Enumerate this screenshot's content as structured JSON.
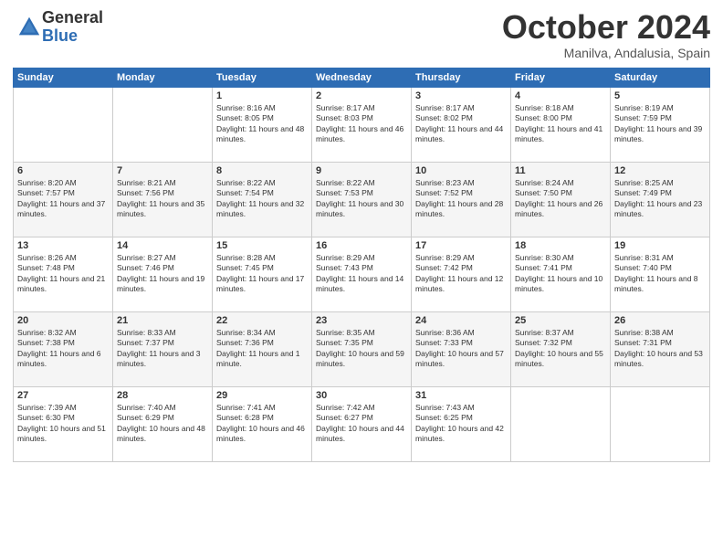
{
  "logo": {
    "general": "General",
    "blue": "Blue"
  },
  "title": "October 2024",
  "subtitle": "Manilva, Andalusia, Spain",
  "days_of_week": [
    "Sunday",
    "Monday",
    "Tuesday",
    "Wednesday",
    "Thursday",
    "Friday",
    "Saturday"
  ],
  "weeks": [
    [
      {
        "day": "",
        "info": ""
      },
      {
        "day": "",
        "info": ""
      },
      {
        "day": "1",
        "info": "Sunrise: 8:16 AM\nSunset: 8:05 PM\nDaylight: 11 hours and 48 minutes."
      },
      {
        "day": "2",
        "info": "Sunrise: 8:17 AM\nSunset: 8:03 PM\nDaylight: 11 hours and 46 minutes."
      },
      {
        "day": "3",
        "info": "Sunrise: 8:17 AM\nSunset: 8:02 PM\nDaylight: 11 hours and 44 minutes."
      },
      {
        "day": "4",
        "info": "Sunrise: 8:18 AM\nSunset: 8:00 PM\nDaylight: 11 hours and 41 minutes."
      },
      {
        "day": "5",
        "info": "Sunrise: 8:19 AM\nSunset: 7:59 PM\nDaylight: 11 hours and 39 minutes."
      }
    ],
    [
      {
        "day": "6",
        "info": "Sunrise: 8:20 AM\nSunset: 7:57 PM\nDaylight: 11 hours and 37 minutes."
      },
      {
        "day": "7",
        "info": "Sunrise: 8:21 AM\nSunset: 7:56 PM\nDaylight: 11 hours and 35 minutes."
      },
      {
        "day": "8",
        "info": "Sunrise: 8:22 AM\nSunset: 7:54 PM\nDaylight: 11 hours and 32 minutes."
      },
      {
        "day": "9",
        "info": "Sunrise: 8:22 AM\nSunset: 7:53 PM\nDaylight: 11 hours and 30 minutes."
      },
      {
        "day": "10",
        "info": "Sunrise: 8:23 AM\nSunset: 7:52 PM\nDaylight: 11 hours and 28 minutes."
      },
      {
        "day": "11",
        "info": "Sunrise: 8:24 AM\nSunset: 7:50 PM\nDaylight: 11 hours and 26 minutes."
      },
      {
        "day": "12",
        "info": "Sunrise: 8:25 AM\nSunset: 7:49 PM\nDaylight: 11 hours and 23 minutes."
      }
    ],
    [
      {
        "day": "13",
        "info": "Sunrise: 8:26 AM\nSunset: 7:48 PM\nDaylight: 11 hours and 21 minutes."
      },
      {
        "day": "14",
        "info": "Sunrise: 8:27 AM\nSunset: 7:46 PM\nDaylight: 11 hours and 19 minutes."
      },
      {
        "day": "15",
        "info": "Sunrise: 8:28 AM\nSunset: 7:45 PM\nDaylight: 11 hours and 17 minutes."
      },
      {
        "day": "16",
        "info": "Sunrise: 8:29 AM\nSunset: 7:43 PM\nDaylight: 11 hours and 14 minutes."
      },
      {
        "day": "17",
        "info": "Sunrise: 8:29 AM\nSunset: 7:42 PM\nDaylight: 11 hours and 12 minutes."
      },
      {
        "day": "18",
        "info": "Sunrise: 8:30 AM\nSunset: 7:41 PM\nDaylight: 11 hours and 10 minutes."
      },
      {
        "day": "19",
        "info": "Sunrise: 8:31 AM\nSunset: 7:40 PM\nDaylight: 11 hours and 8 minutes."
      }
    ],
    [
      {
        "day": "20",
        "info": "Sunrise: 8:32 AM\nSunset: 7:38 PM\nDaylight: 11 hours and 6 minutes."
      },
      {
        "day": "21",
        "info": "Sunrise: 8:33 AM\nSunset: 7:37 PM\nDaylight: 11 hours and 3 minutes."
      },
      {
        "day": "22",
        "info": "Sunrise: 8:34 AM\nSunset: 7:36 PM\nDaylight: 11 hours and 1 minute."
      },
      {
        "day": "23",
        "info": "Sunrise: 8:35 AM\nSunset: 7:35 PM\nDaylight: 10 hours and 59 minutes."
      },
      {
        "day": "24",
        "info": "Sunrise: 8:36 AM\nSunset: 7:33 PM\nDaylight: 10 hours and 57 minutes."
      },
      {
        "day": "25",
        "info": "Sunrise: 8:37 AM\nSunset: 7:32 PM\nDaylight: 10 hours and 55 minutes."
      },
      {
        "day": "26",
        "info": "Sunrise: 8:38 AM\nSunset: 7:31 PM\nDaylight: 10 hours and 53 minutes."
      }
    ],
    [
      {
        "day": "27",
        "info": "Sunrise: 7:39 AM\nSunset: 6:30 PM\nDaylight: 10 hours and 51 minutes."
      },
      {
        "day": "28",
        "info": "Sunrise: 7:40 AM\nSunset: 6:29 PM\nDaylight: 10 hours and 48 minutes."
      },
      {
        "day": "29",
        "info": "Sunrise: 7:41 AM\nSunset: 6:28 PM\nDaylight: 10 hours and 46 minutes."
      },
      {
        "day": "30",
        "info": "Sunrise: 7:42 AM\nSunset: 6:27 PM\nDaylight: 10 hours and 44 minutes."
      },
      {
        "day": "31",
        "info": "Sunrise: 7:43 AM\nSunset: 6:25 PM\nDaylight: 10 hours and 42 minutes."
      },
      {
        "day": "",
        "info": ""
      },
      {
        "day": "",
        "info": ""
      }
    ]
  ]
}
